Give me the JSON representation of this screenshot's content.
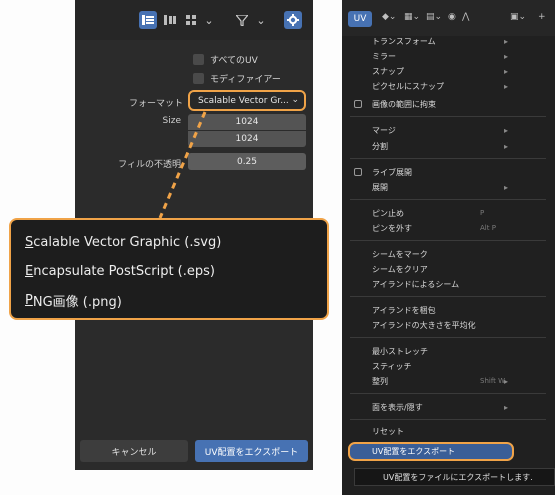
{
  "left": {
    "checkboxes": [
      {
        "label": "すべてのUV",
        "checked": false
      },
      {
        "label": "モディファイアー",
        "checked": false
      }
    ],
    "format_label": "フォーマット",
    "format_value": "Scalable Vector Gr...",
    "size_label": "Size",
    "size_x": "1024",
    "size_y": "1024",
    "fill_label": "フィルの不透明",
    "fill_value": "0.25",
    "format_options": [
      "Scalable Vector Graphic (.svg)",
      "Encapsulate PostScript (.eps)",
      "PNG画像 (.png)"
    ],
    "cancel_label": "キャンセル",
    "export_label": "UV配置をエクスポート",
    "accent": "#4772b3",
    "highlight": "#f0a348"
  },
  "right": {
    "tab_label": "UV",
    "menu_items": [
      {
        "label": "トランスフォーム",
        "submenu": true
      },
      {
        "label": "ミラー",
        "submenu": true
      },
      {
        "label": "スナップ",
        "submenu": true
      },
      {
        "label": "ピクセルにスナップ",
        "submenu": true
      },
      {
        "label": "画像の範囲に拘束",
        "checkbox": true
      },
      {
        "label": "マージ",
        "submenu": true
      },
      {
        "label": "分割",
        "submenu": true
      },
      {
        "label": "ライブ展開",
        "checkbox": true
      },
      {
        "label": "展開",
        "submenu": true
      },
      {
        "label": "ピン止め",
        "shortcut": "P"
      },
      {
        "label": "ピンを外す",
        "shortcut": "Alt P"
      },
      {
        "label": "シームをマーク"
      },
      {
        "label": "シームをクリア"
      },
      {
        "label": "アイランドによるシーム"
      },
      {
        "label": "アイランドを梱包"
      },
      {
        "label": "アイランドの大きさを平均化"
      },
      {
        "label": "最小ストレッチ"
      },
      {
        "label": "スティッチ"
      },
      {
        "label": "整列",
        "shortcut": "Shift W"
      },
      {
        "label": "面を表示/隠す",
        "submenu": true
      },
      {
        "label": "リセット"
      }
    ],
    "export_item": "UV配置をエクスポート",
    "tooltip": "UV配置をファイルにエクスポートします."
  }
}
